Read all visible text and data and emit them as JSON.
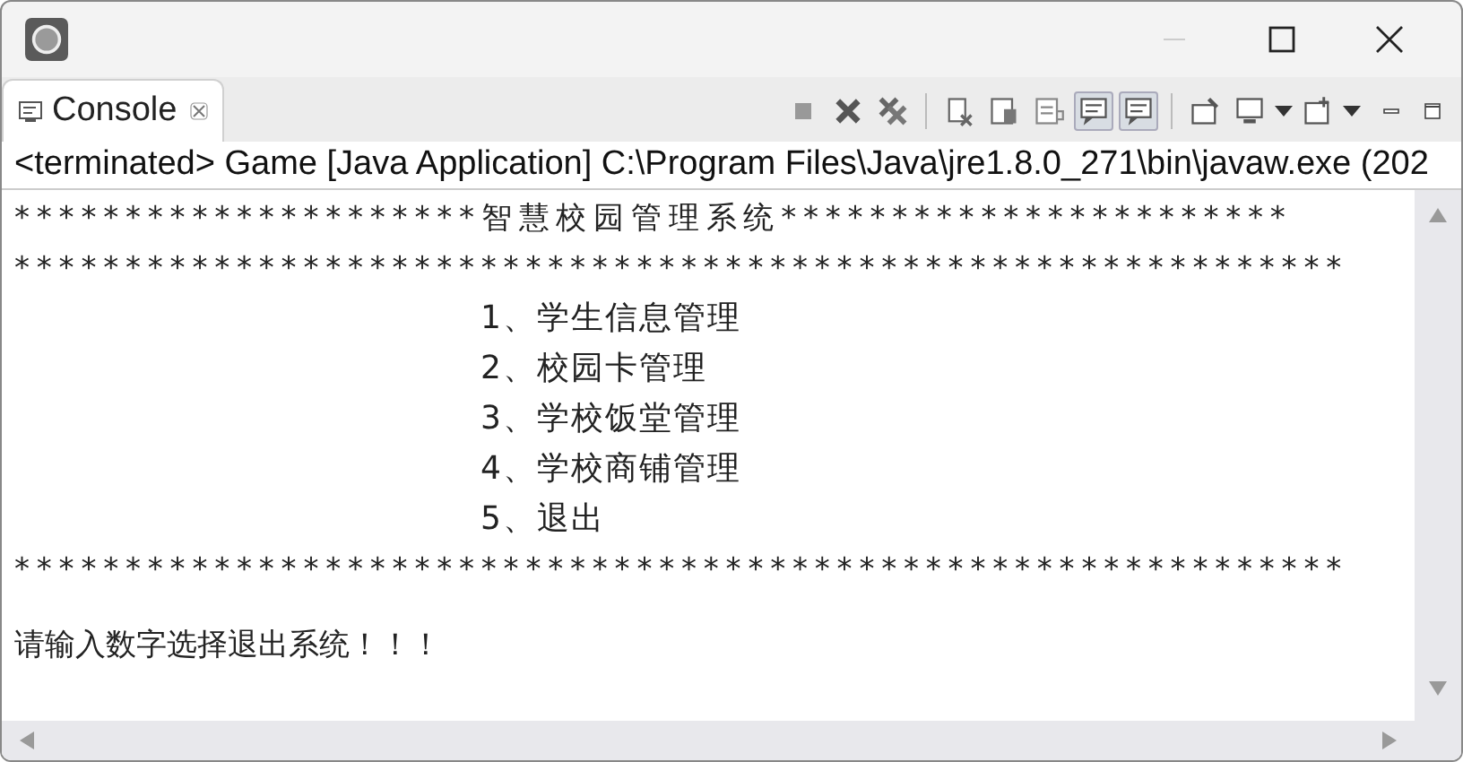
{
  "tab": {
    "label": "Console",
    "selected": true
  },
  "process": "<terminated> Game [Java Application] C:\\Program Files\\Java\\jre1.8.0_271\\bin\\javaw.exe (202",
  "output": [
    {
      "kind": "banner",
      "text": "*********************智慧校园管理系统***********************"
    },
    {
      "kind": "banner",
      "text": "************************************************************"
    },
    {
      "kind": "menu",
      "text": "1、学生信息管理"
    },
    {
      "kind": "menu",
      "text": "2、校园卡管理"
    },
    {
      "kind": "menu",
      "text": "3、学校饭堂管理"
    },
    {
      "kind": "menu",
      "text": "4、学校商铺管理"
    },
    {
      "kind": "menu",
      "text": "5、退出"
    },
    {
      "kind": "banner",
      "text": "************************************************************"
    },
    {
      "kind": "prompt",
      "text": "请输入数字选择退出系统！！！"
    }
  ]
}
